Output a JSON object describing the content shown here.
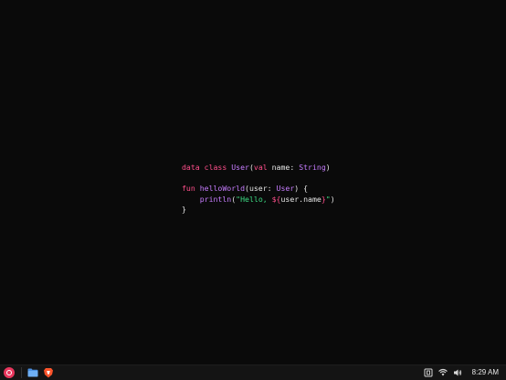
{
  "editor": {
    "lines": [
      [
        {
          "text": "data class ",
          "cls": "kw"
        },
        {
          "text": "User",
          "cls": "ty"
        },
        {
          "text": "(",
          "cls": "pl"
        },
        {
          "text": "val",
          "cls": "kw"
        },
        {
          "text": " name: ",
          "cls": "pl"
        },
        {
          "text": "String",
          "cls": "ty"
        },
        {
          "text": ")",
          "cls": "pl"
        }
      ],
      [],
      [
        {
          "text": "fun ",
          "cls": "kw"
        },
        {
          "text": "helloWorld",
          "cls": "fn"
        },
        {
          "text": "(user: ",
          "cls": "pl"
        },
        {
          "text": "User",
          "cls": "ty"
        },
        {
          "text": ") {",
          "cls": "pl"
        }
      ],
      [
        {
          "text": "    ",
          "cls": "pl"
        },
        {
          "text": "println",
          "cls": "fn"
        },
        {
          "text": "(",
          "cls": "pl"
        },
        {
          "text": "\"Hello, ",
          "cls": "str"
        },
        {
          "text": "${",
          "cls": "tpl"
        },
        {
          "text": "user.name",
          "cls": "pl"
        },
        {
          "text": "}",
          "cls": "tpl"
        },
        {
          "text": "\"",
          "cls": "str"
        },
        {
          "text": ")",
          "cls": "pl"
        }
      ],
      [
        {
          "text": "}",
          "cls": "pl"
        }
      ]
    ]
  },
  "taskbar": {
    "launcher_icon": "launcher-icon",
    "apps": [
      {
        "name": "files-icon",
        "color": "#4a90e2"
      },
      {
        "name": "brave-browser-icon",
        "color": "#fb542b"
      }
    ],
    "tray": [
      {
        "name": "keyboard-layout-icon"
      },
      {
        "name": "wifi-icon"
      },
      {
        "name": "volume-icon"
      }
    ],
    "clock": "8:29 AM"
  },
  "colors": {
    "background": "#0a0a0a",
    "taskbar": "#141414",
    "keyword": "#ff4f8b",
    "type": "#c77dff",
    "string": "#3ddc84"
  }
}
